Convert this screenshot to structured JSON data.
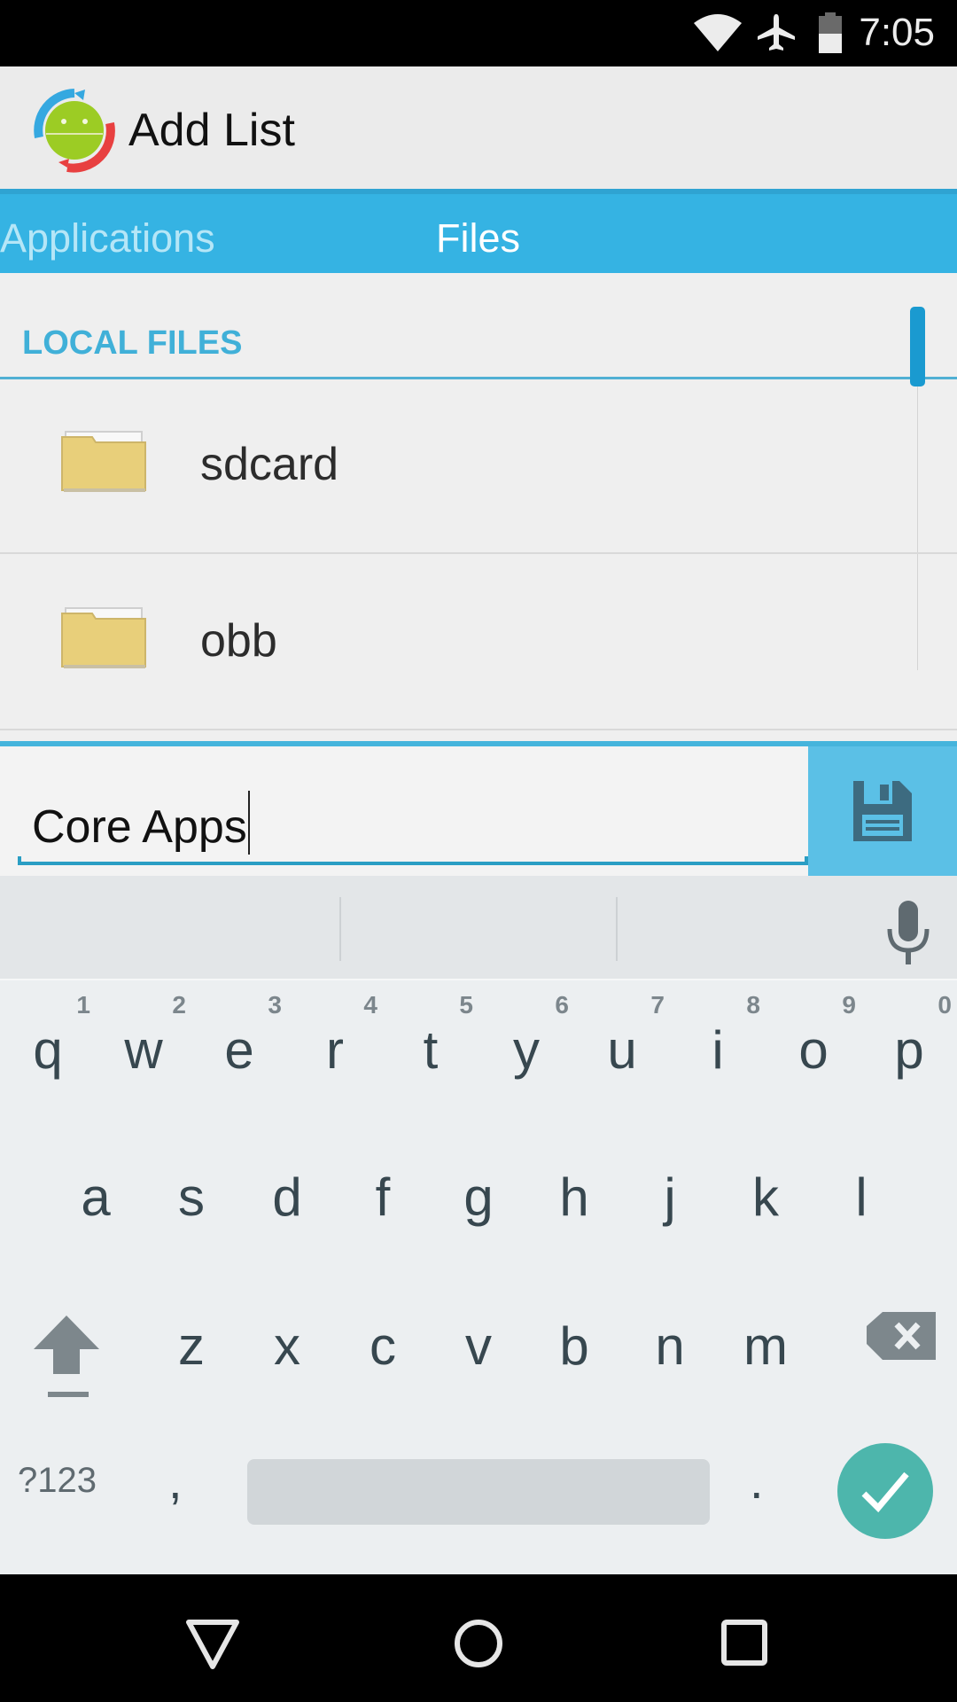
{
  "status_bar": {
    "time": "7:05",
    "icons": [
      "wifi-icon",
      "airplane-mode-icon",
      "battery-icon"
    ]
  },
  "action_bar": {
    "title": "Add List",
    "logo": "app-logo-android-sync"
  },
  "tabs": [
    {
      "label": "Applications",
      "selected": false
    },
    {
      "label": "Files",
      "selected": true
    }
  ],
  "content": {
    "section_header": "LOCAL FILES",
    "files": [
      {
        "name": "sdcard",
        "icon": "folder-icon"
      },
      {
        "name": "obb",
        "icon": "folder-icon"
      }
    ]
  },
  "input": {
    "value": "Core Apps",
    "save_icon": "save-icon"
  },
  "keyboard": {
    "suggestions": [
      "",
      "",
      ""
    ],
    "row1": [
      {
        "letter": "q",
        "hint": "1"
      },
      {
        "letter": "w",
        "hint": "2"
      },
      {
        "letter": "e",
        "hint": "3"
      },
      {
        "letter": "r",
        "hint": "4"
      },
      {
        "letter": "t",
        "hint": "5"
      },
      {
        "letter": "y",
        "hint": "6"
      },
      {
        "letter": "u",
        "hint": "7"
      },
      {
        "letter": "i",
        "hint": "8"
      },
      {
        "letter": "o",
        "hint": "9"
      },
      {
        "letter": "p",
        "hint": "0"
      }
    ],
    "row2": [
      "a",
      "s",
      "d",
      "f",
      "g",
      "h",
      "j",
      "k",
      "l"
    ],
    "row3": [
      "z",
      "x",
      "c",
      "v",
      "b",
      "n",
      "m"
    ],
    "symbols_label": "?123",
    "comma": ",",
    "period": ".",
    "colors": {
      "done": "#4db6ac",
      "key_text": "#37474f"
    }
  },
  "nav_bar": {
    "buttons": [
      "back-icon",
      "home-icon",
      "recents-icon"
    ]
  },
  "colors": {
    "accent": "#35b3e3",
    "section_header": "#40b0d8"
  }
}
